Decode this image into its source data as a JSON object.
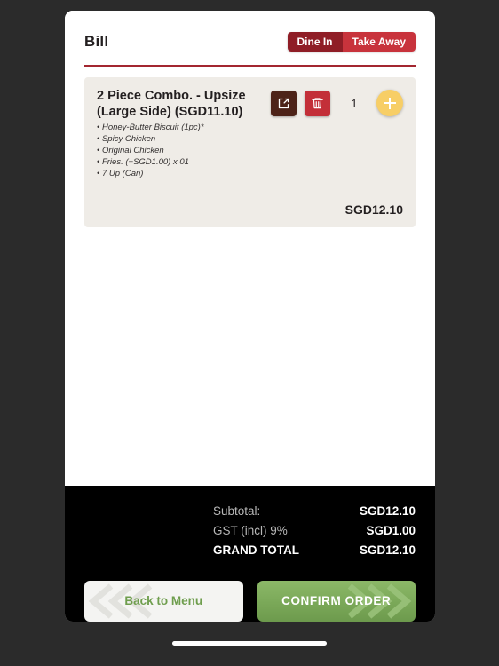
{
  "header": {
    "title": "Bill",
    "order_types": [
      {
        "label": "Dine In",
        "state": "inactive"
      },
      {
        "label": "Take Away",
        "state": "active"
      }
    ],
    "accent_color": "#a32630"
  },
  "items": [
    {
      "name": "2 Piece Combo. - Upsize (Large Side) (SGD11.10)",
      "options": [
        "Honey-Butter Biscuit (1pc)*",
        "Spicy Chicken",
        "Original Chicken",
        "Fries. (+SGD1.00) x 01",
        "7 Up (Can)"
      ],
      "quantity": "1",
      "price": "SGD12.10",
      "edit_icon": "edit-square-icon",
      "delete_icon": "trash-icon",
      "add_icon": "plus-icon"
    }
  ],
  "totals": {
    "subtotal_label": "Subtotal:",
    "subtotal_value": "SGD12.10",
    "gst_label": "GST (incl) 9%",
    "gst_value": "SGD1.00",
    "grand_label": "GRAND TOTAL",
    "grand_value": "SGD12.10"
  },
  "actions": {
    "back_label": "Back to Menu",
    "back_icon": "chevron-left-icon",
    "confirm_label": "CONFIRM ORDER",
    "confirm_icon": "chevron-right-icon",
    "back_color": "#6f9e4e",
    "confirm_color": "#7aa858"
  }
}
